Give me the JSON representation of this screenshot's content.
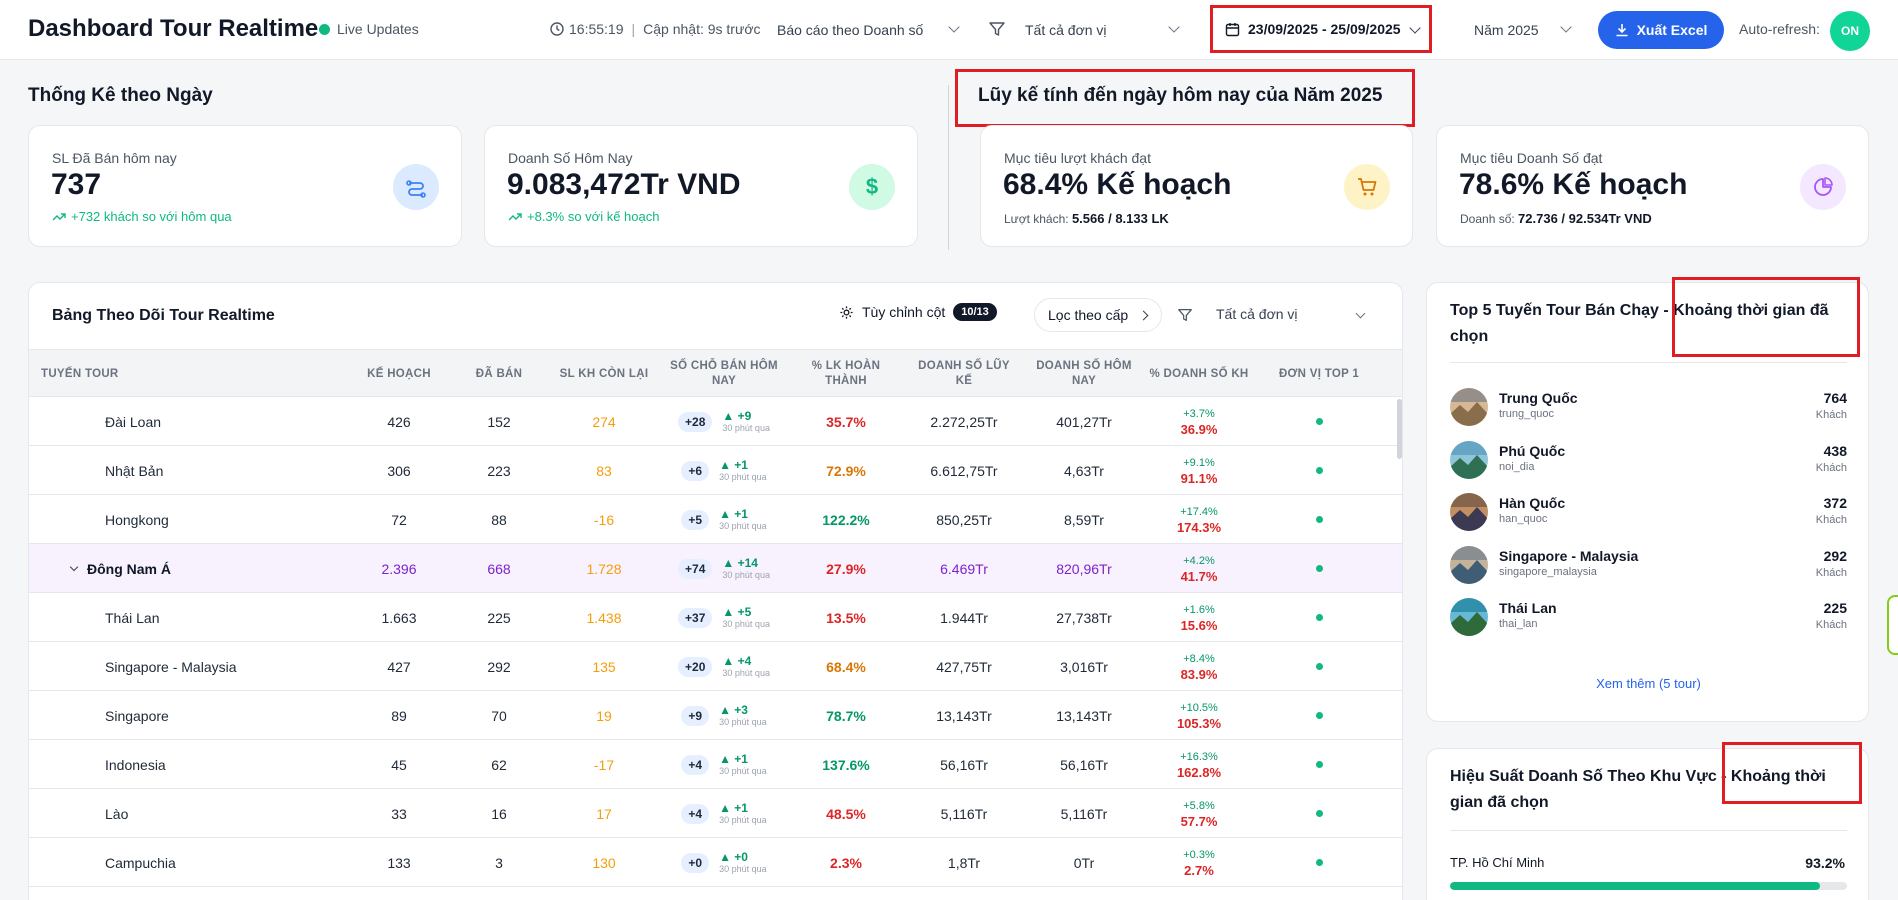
{
  "header": {
    "title": "Dashboard Tour Realtime",
    "live_label": "Live Updates",
    "clock": "16:55:19",
    "updated": "Cập nhật: 9s trước",
    "report_select": "Báo cáo theo Doanh số",
    "unit_select": "Tất cả đơn vị",
    "date_range": "23/09/2025 - 25/09/2025",
    "year_select": "Năm 2025",
    "export_label": "Xuất Excel",
    "autorefresh_label": "Auto-refresh:",
    "autorefresh_state": "ON"
  },
  "daily": {
    "title": "Thống Kê theo Ngày",
    "cards": [
      {
        "label": "SL Đã Bán hôm nay",
        "value": "737",
        "sub": "+732 khách so với hôm qua",
        "icon": "transfer-icon"
      },
      {
        "label": "Doanh Số Hôm Nay",
        "value": "9.083,472Tr VND",
        "sub": "+8.3% so với kế hoạch",
        "icon": "dollar-icon"
      }
    ]
  },
  "cumulative": {
    "title": "Lũy kế tính đến ngày hôm nay của Năm 2025",
    "cards": [
      {
        "label": "Mục tiêu lượt khách đạt",
        "value": "68.4% Kế hoạch",
        "sub_label": "Lượt khách:",
        "sub_value": "5.566 / 8.133 LK",
        "icon": "cart-icon"
      },
      {
        "label": "Mục tiêu Doanh Số đạt",
        "value": "78.6% Kế hoạch",
        "sub_label": "Doanh số:",
        "sub_value": "72.736 / 92.534Tr VND",
        "icon": "pie-icon"
      }
    ]
  },
  "table": {
    "title": "Bảng Theo Dõi Tour Realtime",
    "customize_label": "Tùy chỉnh cột",
    "customize_badge": "10/13",
    "level_filter_label": "Lọc theo cấp",
    "unit_select": "Tất cả đơn vị",
    "columns": [
      "TUYẾN TOUR",
      "KẾ HOẠCH",
      "ĐÃ BÁN",
      "SL KH CÒN LẠI",
      "SỐ CHỖ BÁN HÔM NAY",
      "% LK HOÀN THÀNH",
      "DOANH SỐ LŨY KẾ",
      "DOANH SỐ HÔM NAY",
      "% DOANH SỐ KH",
      "ĐƠN VỊ TOP 1"
    ],
    "rows": [
      {
        "name": "Đài Loan",
        "plan": "426",
        "sold": "152",
        "remaining": "274",
        "seats": "+28",
        "trend": "▲ +9",
        "trend_note": "30 phút qua",
        "pct_done": "35.7%",
        "pct_color": "red",
        "rev_cum": "2.272,25Tr",
        "rev_today": "401,27Tr",
        "kh_delta": "+3.7%",
        "kh_pct": "36.9%",
        "group": false
      },
      {
        "name": "Nhật Bản",
        "plan": "306",
        "sold": "223",
        "remaining": "83",
        "seats": "+6",
        "trend": "▲ +1",
        "trend_note": "30 phút qua",
        "pct_done": "72.9%",
        "pct_color": "orange",
        "rev_cum": "6.612,75Tr",
        "rev_today": "4,63Tr",
        "kh_delta": "+9.1%",
        "kh_pct": "91.1%",
        "group": false
      },
      {
        "name": "Hongkong",
        "plan": "72",
        "sold": "88",
        "remaining": "-16",
        "seats": "+5",
        "trend": "▲ +1",
        "trend_note": "30 phút qua",
        "pct_done": "122.2%",
        "pct_color": "green",
        "rev_cum": "850,25Tr",
        "rev_today": "8,59Tr",
        "kh_delta": "+17.4%",
        "kh_pct": "174.3%",
        "group": false
      },
      {
        "name": "Đông Nam Á",
        "plan": "2.396",
        "sold": "668",
        "remaining": "1.728",
        "seats": "+74",
        "trend": "▲ +14",
        "trend_note": "30 phút qua",
        "pct_done": "27.9%",
        "pct_color": "red",
        "rev_cum": "6.469Tr",
        "rev_today": "820,96Tr",
        "kh_delta": "+4.2%",
        "kh_pct": "41.7%",
        "group": true
      },
      {
        "name": "Thái Lan",
        "plan": "1.663",
        "sold": "225",
        "remaining": "1.438",
        "seats": "+37",
        "trend": "▲ +5",
        "trend_note": "30 phút qua",
        "pct_done": "13.5%",
        "pct_color": "red",
        "rev_cum": "1.944Tr",
        "rev_today": "27,738Tr",
        "kh_delta": "+1.6%",
        "kh_pct": "15.6%",
        "group": false
      },
      {
        "name": "Singapore - Malaysia",
        "plan": "427",
        "sold": "292",
        "remaining": "135",
        "seats": "+20",
        "trend": "▲ +4",
        "trend_note": "30 phút qua",
        "pct_done": "68.4%",
        "pct_color": "orange",
        "rev_cum": "427,75Tr",
        "rev_today": "3,016Tr",
        "kh_delta": "+8.4%",
        "kh_pct": "83.9%",
        "group": false
      },
      {
        "name": "Singapore",
        "plan": "89",
        "sold": "70",
        "remaining": "19",
        "seats": "+9",
        "trend": "▲ +3",
        "trend_note": "30 phút qua",
        "pct_done": "78.7%",
        "pct_color": "green",
        "rev_cum": "13,143Tr",
        "rev_today": "13,143Tr",
        "kh_delta": "+10.5%",
        "kh_pct": "105.3%",
        "group": false
      },
      {
        "name": "Indonesia",
        "plan": "45",
        "sold": "62",
        "remaining": "-17",
        "seats": "+4",
        "trend": "▲ +1",
        "trend_note": "30 phút qua",
        "pct_done": "137.6%",
        "pct_color": "green",
        "rev_cum": "56,16Tr",
        "rev_today": "56,16Tr",
        "kh_delta": "+16.3%",
        "kh_pct": "162.8%",
        "group": false
      },
      {
        "name": "Lào",
        "plan": "33",
        "sold": "16",
        "remaining": "17",
        "seats": "+4",
        "trend": "▲ +1",
        "trend_note": "30 phút qua",
        "pct_done": "48.5%",
        "pct_color": "red",
        "rev_cum": "5,116Tr",
        "rev_today": "5,116Tr",
        "kh_delta": "+5.8%",
        "kh_pct": "57.7%",
        "group": false
      },
      {
        "name": "Campuchia",
        "plan": "133",
        "sold": "3",
        "remaining": "130",
        "seats": "+0",
        "trend": "▲ +0",
        "trend_note": "30 phút qua",
        "pct_done": "2.3%",
        "pct_color": "red",
        "rev_cum": "1,8Tr",
        "rev_today": "0Tr",
        "kh_delta": "+0.3%",
        "kh_pct": "2.7%",
        "group": false
      }
    ]
  },
  "top_tours": {
    "title": "Top 5 Tuyến Tour Bán Chạy - Khoảng thời gian đã chọn",
    "unit": "Khách",
    "items": [
      {
        "name": "Trung Quốc",
        "code": "trung_quoc",
        "count": "764"
      },
      {
        "name": "Phú Quốc",
        "code": "noi_dia",
        "count": "438"
      },
      {
        "name": "Hàn Quốc",
        "code": "han_quoc",
        "count": "372"
      },
      {
        "name": "Singapore - Malaysia",
        "code": "singapore_malaysia",
        "count": "292"
      },
      {
        "name": "Thái Lan",
        "code": "thai_lan",
        "count": "225"
      }
    ],
    "see_more": "Xem thêm (5 tour)"
  },
  "region_perf": {
    "title": "Hiệu Suất Doanh Số Theo Khu Vực - Khoảng thời gian đã chọn",
    "regions": [
      {
        "name": "TP. Hồ Chí Minh",
        "pct": "93.2%",
        "fill": 0.932
      }
    ]
  },
  "colors": {
    "accent_blue": "#2563eb",
    "highlight_red": "#e11d24",
    "success_green": "#10b981",
    "group_purple": "#7e22ce"
  }
}
